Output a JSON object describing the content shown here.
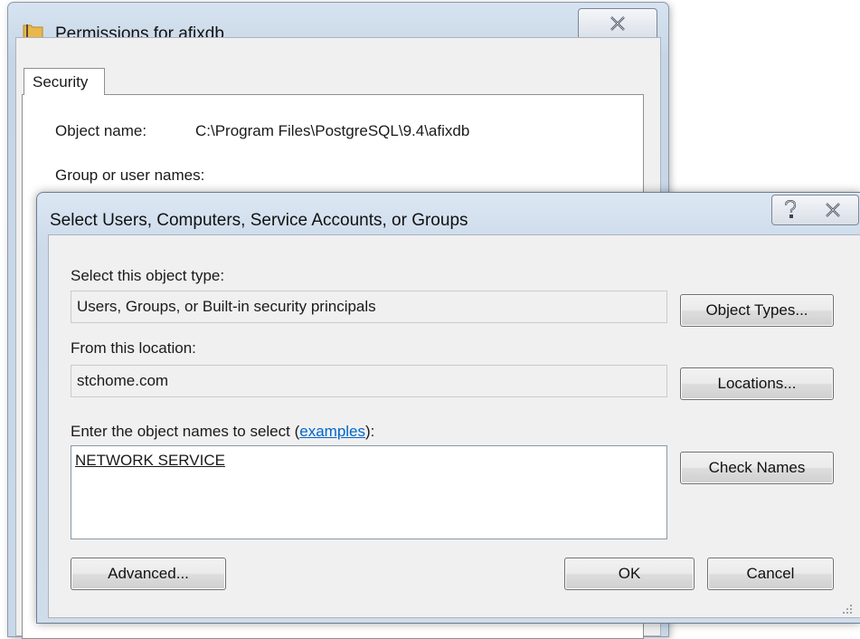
{
  "permissions_window": {
    "title": "Permissions for afixdb",
    "tab_label": "Security",
    "object_name_label": "Object name:",
    "object_name_value": "C:\\Program Files\\PostgreSQL\\9.4\\afixdb",
    "group_label": "Group or user names:"
  },
  "select_dialog": {
    "title": "Select Users, Computers, Service Accounts, or Groups",
    "object_type_label": "Select this object type:",
    "object_type_value": "Users, Groups, or Built-in security principals",
    "object_types_button": "Object Types...",
    "location_label": "From this location:",
    "location_value": "stchome.com",
    "locations_button": "Locations...",
    "enter_names_prefix": "Enter the object names to select (",
    "examples_link": "examples",
    "enter_names_suffix": "):",
    "names_value": "NETWORK SERVICE",
    "check_names_button": "Check Names",
    "advanced_button": "Advanced...",
    "ok_button": "OK",
    "cancel_button": "Cancel"
  },
  "icons": [
    "folder-icon",
    "close-icon",
    "help-icon",
    "resize-grip-icon"
  ],
  "colors": {
    "link": "#0066cc",
    "titlebar": "#ccdaea",
    "dialog_body": "#f0f0f0"
  }
}
